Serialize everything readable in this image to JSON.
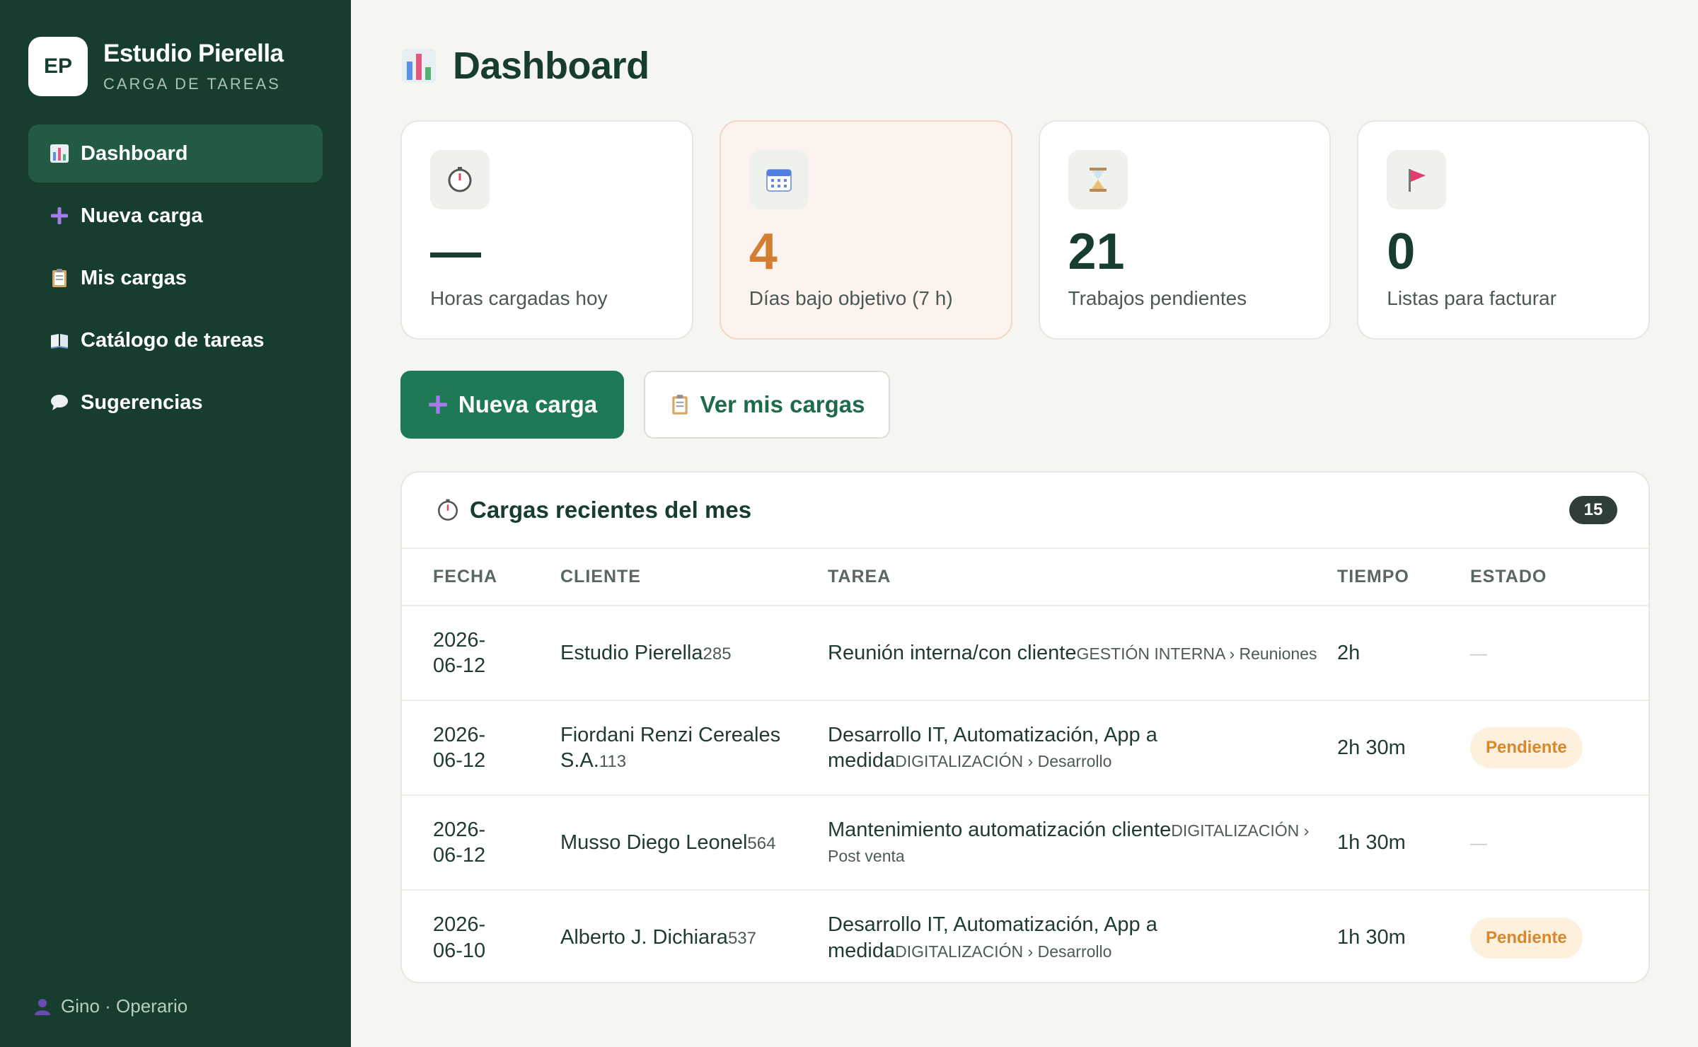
{
  "brand": {
    "initials": "EP",
    "name": "Estudio Pierella",
    "subtitle": "CARGA DE TAREAS"
  },
  "nav": [
    {
      "label": "Dashboard",
      "icon": "bar-chart-icon",
      "active": true
    },
    {
      "label": "Nueva carga",
      "icon": "plus-icon",
      "active": false
    },
    {
      "label": "Mis cargas",
      "icon": "clipboard-icon",
      "active": false
    },
    {
      "label": "Catálogo de tareas",
      "icon": "book-icon",
      "active": false
    },
    {
      "label": "Sugerencias",
      "icon": "speech-bubble-icon",
      "active": false
    }
  ],
  "user": {
    "label": "Gino · Operario",
    "icon": "user-icon"
  },
  "page": {
    "title": "Dashboard"
  },
  "stats": [
    {
      "value": "—",
      "label": "Horas cargadas hoy",
      "icon": "stopwatch-icon"
    },
    {
      "value": "4",
      "label": "Días bajo objetivo (7 h)",
      "icon": "calendar-icon"
    },
    {
      "value": "21",
      "label": "Trabajos pendientes",
      "icon": "hourglass-icon"
    },
    {
      "value": "0",
      "label": "Listas para facturar",
      "icon": "flag-icon"
    }
  ],
  "actions": {
    "primary": "Nueva carga",
    "secondary": "Ver mis cargas"
  },
  "recent": {
    "title": "Cargas recientes del mes",
    "count": "15",
    "headers": {
      "fecha": "FECHA",
      "cliente": "CLIENTE",
      "tarea": "TAREA",
      "tiempo": "TIEMPO",
      "estado": "ESTADO"
    },
    "rows": [
      {
        "fecha": "2026-06-12",
        "cliente": "Estudio Pierella",
        "codigo": "285",
        "tarea": "Reunión interna/con cliente",
        "categoria": "GESTIÓN INTERNA › Reuniones",
        "tiempo": "2h",
        "estado": "—"
      },
      {
        "fecha": "2026-06-12",
        "cliente": "Fiordani Renzi Cereales S.A.",
        "codigo": "113",
        "tarea": "Desarrollo IT, Automatización, App a medida",
        "categoria": "DIGITALIZACIÓN › Desarrollo",
        "tiempo": "2h 30m",
        "estado": "Pendiente"
      },
      {
        "fecha": "2026-06-12",
        "cliente": "Musso Diego Leonel",
        "codigo": "564",
        "tarea": "Mantenimiento automatización cliente",
        "categoria": "DIGITALIZACIÓN › Post venta",
        "tiempo": "1h 30m",
        "estado": "—"
      },
      {
        "fecha": "2026-06-10",
        "cliente": "Alberto J. Dichiara",
        "codigo": "537",
        "tarea": "Desarrollo IT, Automatización, App a medida",
        "categoria": "DIGITALIZACIÓN › Desarrollo",
        "tiempo": "1h 30m",
        "estado": "Pendiente"
      }
    ]
  }
}
